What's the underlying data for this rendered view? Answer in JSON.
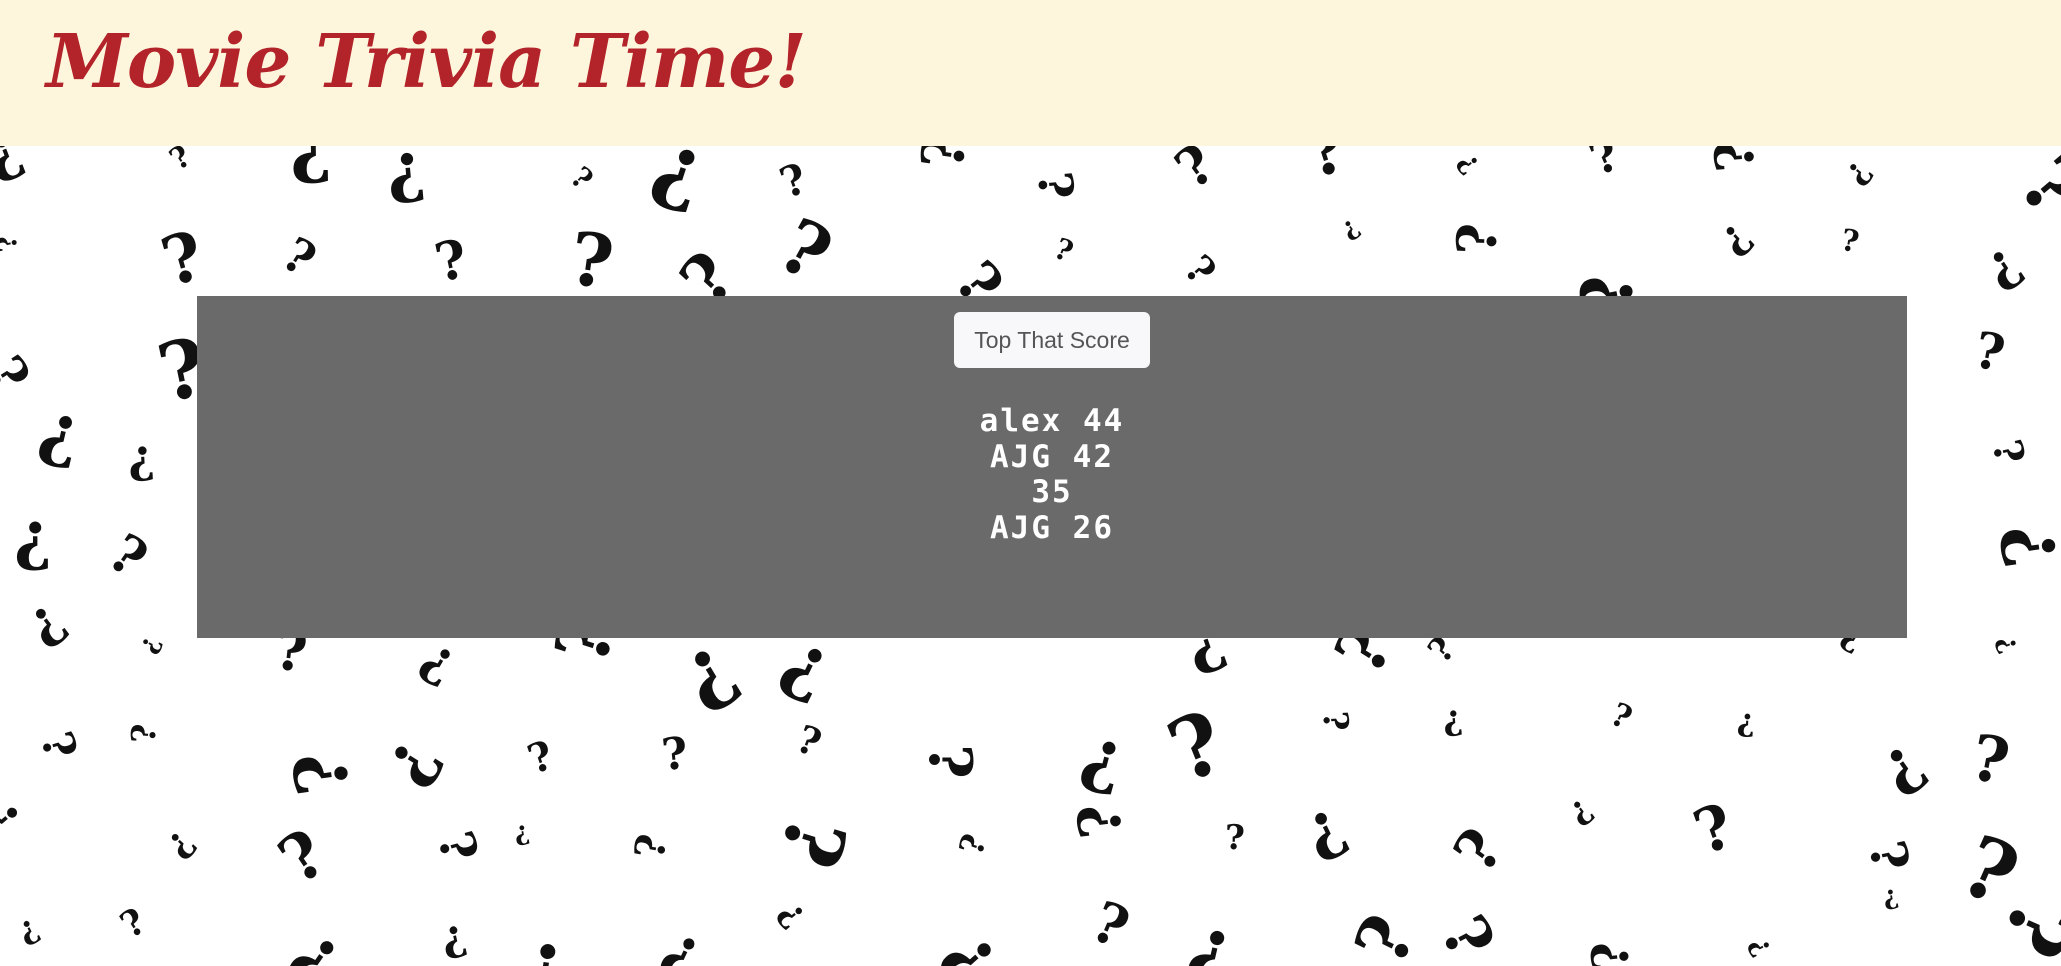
{
  "header": {
    "title": "Movie Trivia Time!"
  },
  "main": {
    "button_label": "Top That Score",
    "scores": [
      {
        "text": "alex 44"
      },
      {
        "text": "AJG 42"
      },
      {
        "text": "35"
      },
      {
        "text": "AJG 26"
      }
    ]
  },
  "colors": {
    "header_bg": "#fef6dc",
    "title": "#b3232a",
    "panel_bg": "#6a6a6a",
    "score_text": "#ffffff"
  }
}
